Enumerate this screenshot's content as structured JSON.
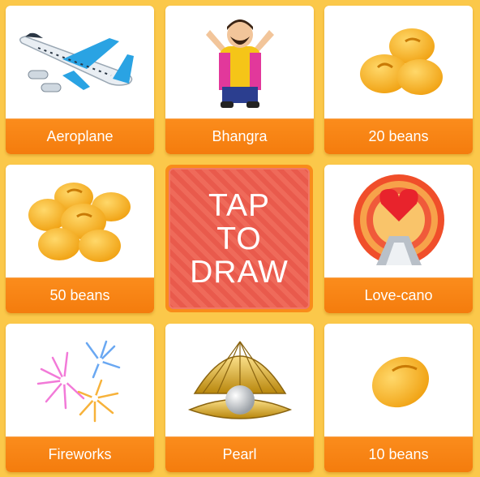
{
  "gifts": [
    {
      "label": "Aeroplane",
      "icon": "aeroplane-icon"
    },
    {
      "label": "Bhangra",
      "icon": "bhangra-dancer-icon"
    },
    {
      "label": "20 beans",
      "icon": "beans-cluster-icon"
    },
    {
      "label": "50 beans",
      "icon": "beans-pile-icon"
    },
    {
      "label": "Love-cano",
      "icon": "love-cano-icon"
    },
    {
      "label": "Fireworks",
      "icon": "fireworks-icon"
    },
    {
      "label": "Pearl",
      "icon": "pearl-shell-icon"
    },
    {
      "label": "10 beans",
      "icon": "single-bean-icon"
    }
  ],
  "draw_button": {
    "label": "TAP\nTO\nDRAW"
  },
  "colors": {
    "background": "#fbc84a",
    "label_bar": "#f47c0d",
    "draw_button": "#e95a4c",
    "bean": "#f6b320"
  }
}
